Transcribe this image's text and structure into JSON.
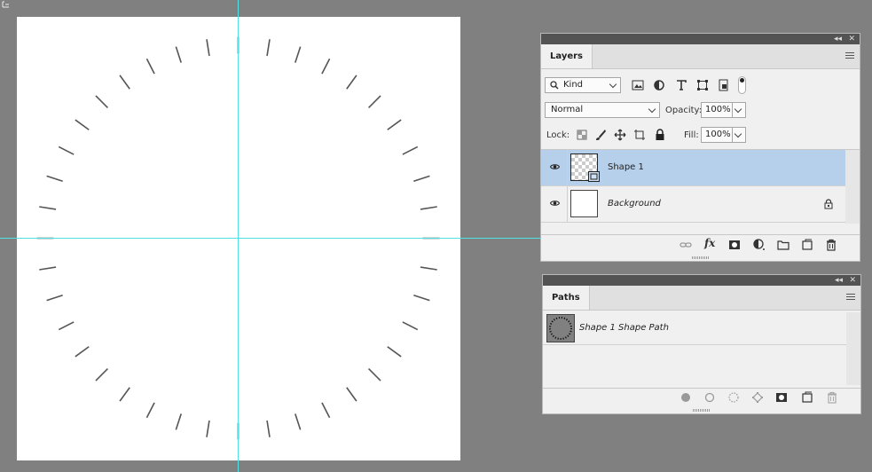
{
  "canvas": {
    "tick_count": 40,
    "tick_color": "#555555",
    "guide_color": "#4fe3e8"
  },
  "layers_panel": {
    "tab": "Layers",
    "filter": {
      "kind_label": "Kind"
    },
    "blend_mode": "Normal",
    "opacity_label": "Opacity:",
    "opacity_value": "100%",
    "lock_label": "Lock:",
    "fill_label": "Fill:",
    "fill_value": "100%",
    "layers": [
      {
        "name": "Shape 1",
        "selected": true,
        "visible": true
      },
      {
        "name": "Background",
        "selected": false,
        "visible": true,
        "locked": true
      }
    ],
    "footer_icons": [
      "link-icon",
      "fx-icon",
      "mask-icon",
      "adjustment-icon",
      "folder-icon",
      "new-layer-icon",
      "trash-icon"
    ]
  },
  "paths_panel": {
    "tab": "Paths",
    "paths": [
      {
        "name": "Shape 1 Shape Path"
      }
    ],
    "footer_icons": [
      "fill-path-icon",
      "stroke-path-icon",
      "selection-icon",
      "work-path-icon",
      "mask-icon",
      "new-path-icon",
      "trash-icon"
    ]
  }
}
